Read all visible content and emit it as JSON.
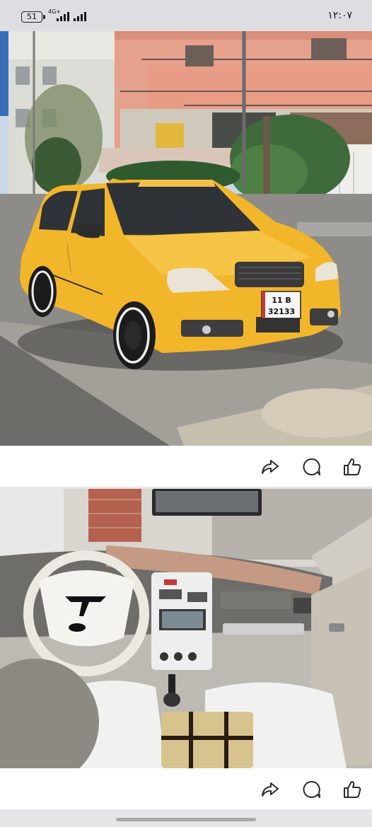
{
  "status_bar": {
    "battery": "51",
    "network": "4G+",
    "time": "١٢:٠٧"
  },
  "posts": [
    {
      "image": "yellow-taxi-sedan-photo",
      "plate": {
        "line1": "11 B",
        "line2": "32133"
      },
      "actions": [
        "share-icon",
        "comment-icon",
        "like-icon"
      ]
    },
    {
      "image": "car-interior-dashboard-photo",
      "actions": [
        "share-icon",
        "comment-icon",
        "like-icon"
      ]
    }
  ],
  "colors": {
    "taxi_yellow": "#f2b62a",
    "icon": "#2b2b2b",
    "background": "#e9e9ea"
  }
}
